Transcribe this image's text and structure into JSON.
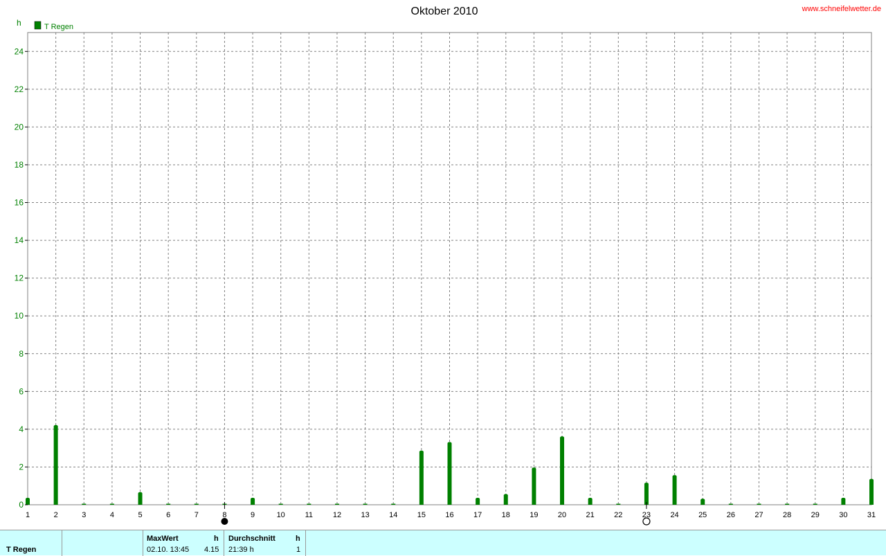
{
  "site_link": "www.schneifelwetter.de",
  "colors": {
    "series": "#008000",
    "stats_bg": "#ccffff",
    "link": "#ff0000"
  },
  "chart_data": {
    "type": "bar",
    "title": "Oktober 2010",
    "ylabel": "h",
    "ylim": [
      0,
      25
    ],
    "yticks": [
      0,
      2,
      4,
      6,
      8,
      10,
      12,
      14,
      16,
      18,
      20,
      22,
      24
    ],
    "xlim": [
      1,
      31
    ],
    "xticks": [
      1,
      2,
      3,
      4,
      5,
      6,
      7,
      8,
      9,
      10,
      11,
      12,
      13,
      14,
      15,
      16,
      17,
      18,
      19,
      20,
      21,
      22,
      23,
      24,
      25,
      26,
      27,
      28,
      29,
      30,
      31
    ],
    "grid": true,
    "legend": "top-left",
    "series": [
      {
        "name": "T Regen",
        "x": [
          1,
          2,
          3,
          4,
          5,
          6,
          7,
          8,
          9,
          10,
          11,
          12,
          13,
          14,
          15,
          16,
          17,
          18,
          19,
          20,
          21,
          22,
          23,
          24,
          25,
          26,
          27,
          28,
          29,
          30,
          31
        ],
        "values": [
          0.3,
          4.15,
          0,
          0,
          0.6,
          0,
          0,
          0,
          0.3,
          0,
          0,
          0,
          0,
          0,
          2.8,
          3.25,
          0.3,
          0.5,
          1.9,
          3.55,
          0.3,
          0,
          1.1,
          1.5,
          0.25,
          0,
          0,
          0,
          0,
          0.3,
          1.3
        ]
      }
    ],
    "moon_phases": [
      {
        "day": 8,
        "phase": "new-moon"
      },
      {
        "day": 23,
        "phase": "full-moon"
      }
    ]
  },
  "stats": {
    "series_label": "T Regen",
    "max_header": "MaxWert",
    "max_unit": "h",
    "max_date": "02.10.  13:45",
    "max_value": "4.15",
    "avg_header": "Durchschnitt",
    "avg_unit": "h",
    "avg_value": "21:39 h",
    "avg_count": "1"
  }
}
